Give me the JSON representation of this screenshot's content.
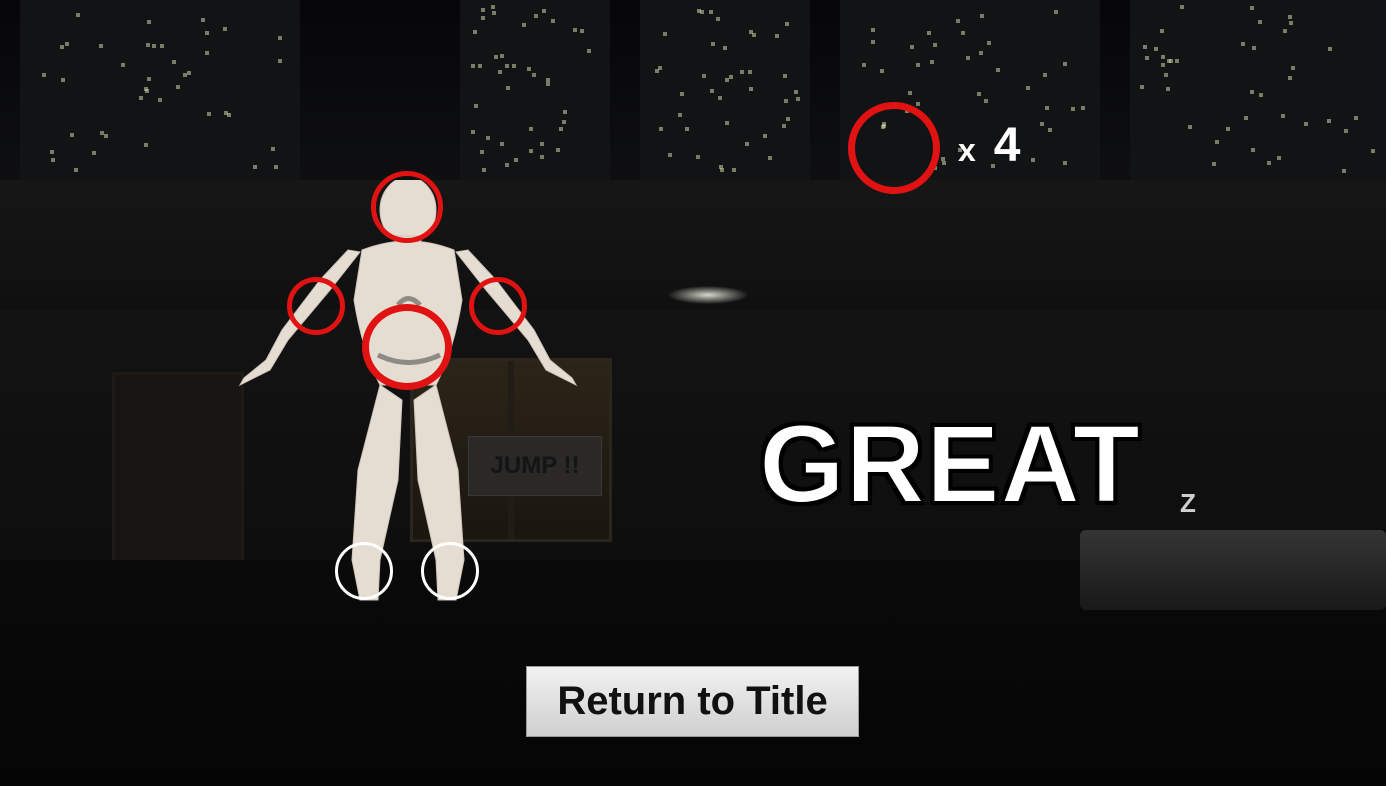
{
  "hud": {
    "counter_prefix": "x",
    "counter_value": "4",
    "rating_text": "GREAT"
  },
  "scene": {
    "sign_text": "JUMP !!",
    "sleep_text": "Z"
  },
  "menu": {
    "return_label": "Return to Title"
  },
  "colors": {
    "target_active": "#e11212",
    "target_inactive": "#ffffff",
    "body": "#e6ddd2"
  },
  "targets": [
    {
      "name": "head",
      "state": "active"
    },
    {
      "name": "right-hand",
      "state": "active"
    },
    {
      "name": "left-hand",
      "state": "active"
    },
    {
      "name": "torso",
      "state": "active"
    },
    {
      "name": "right-foot",
      "state": "inactive"
    },
    {
      "name": "left-foot",
      "state": "inactive"
    }
  ]
}
